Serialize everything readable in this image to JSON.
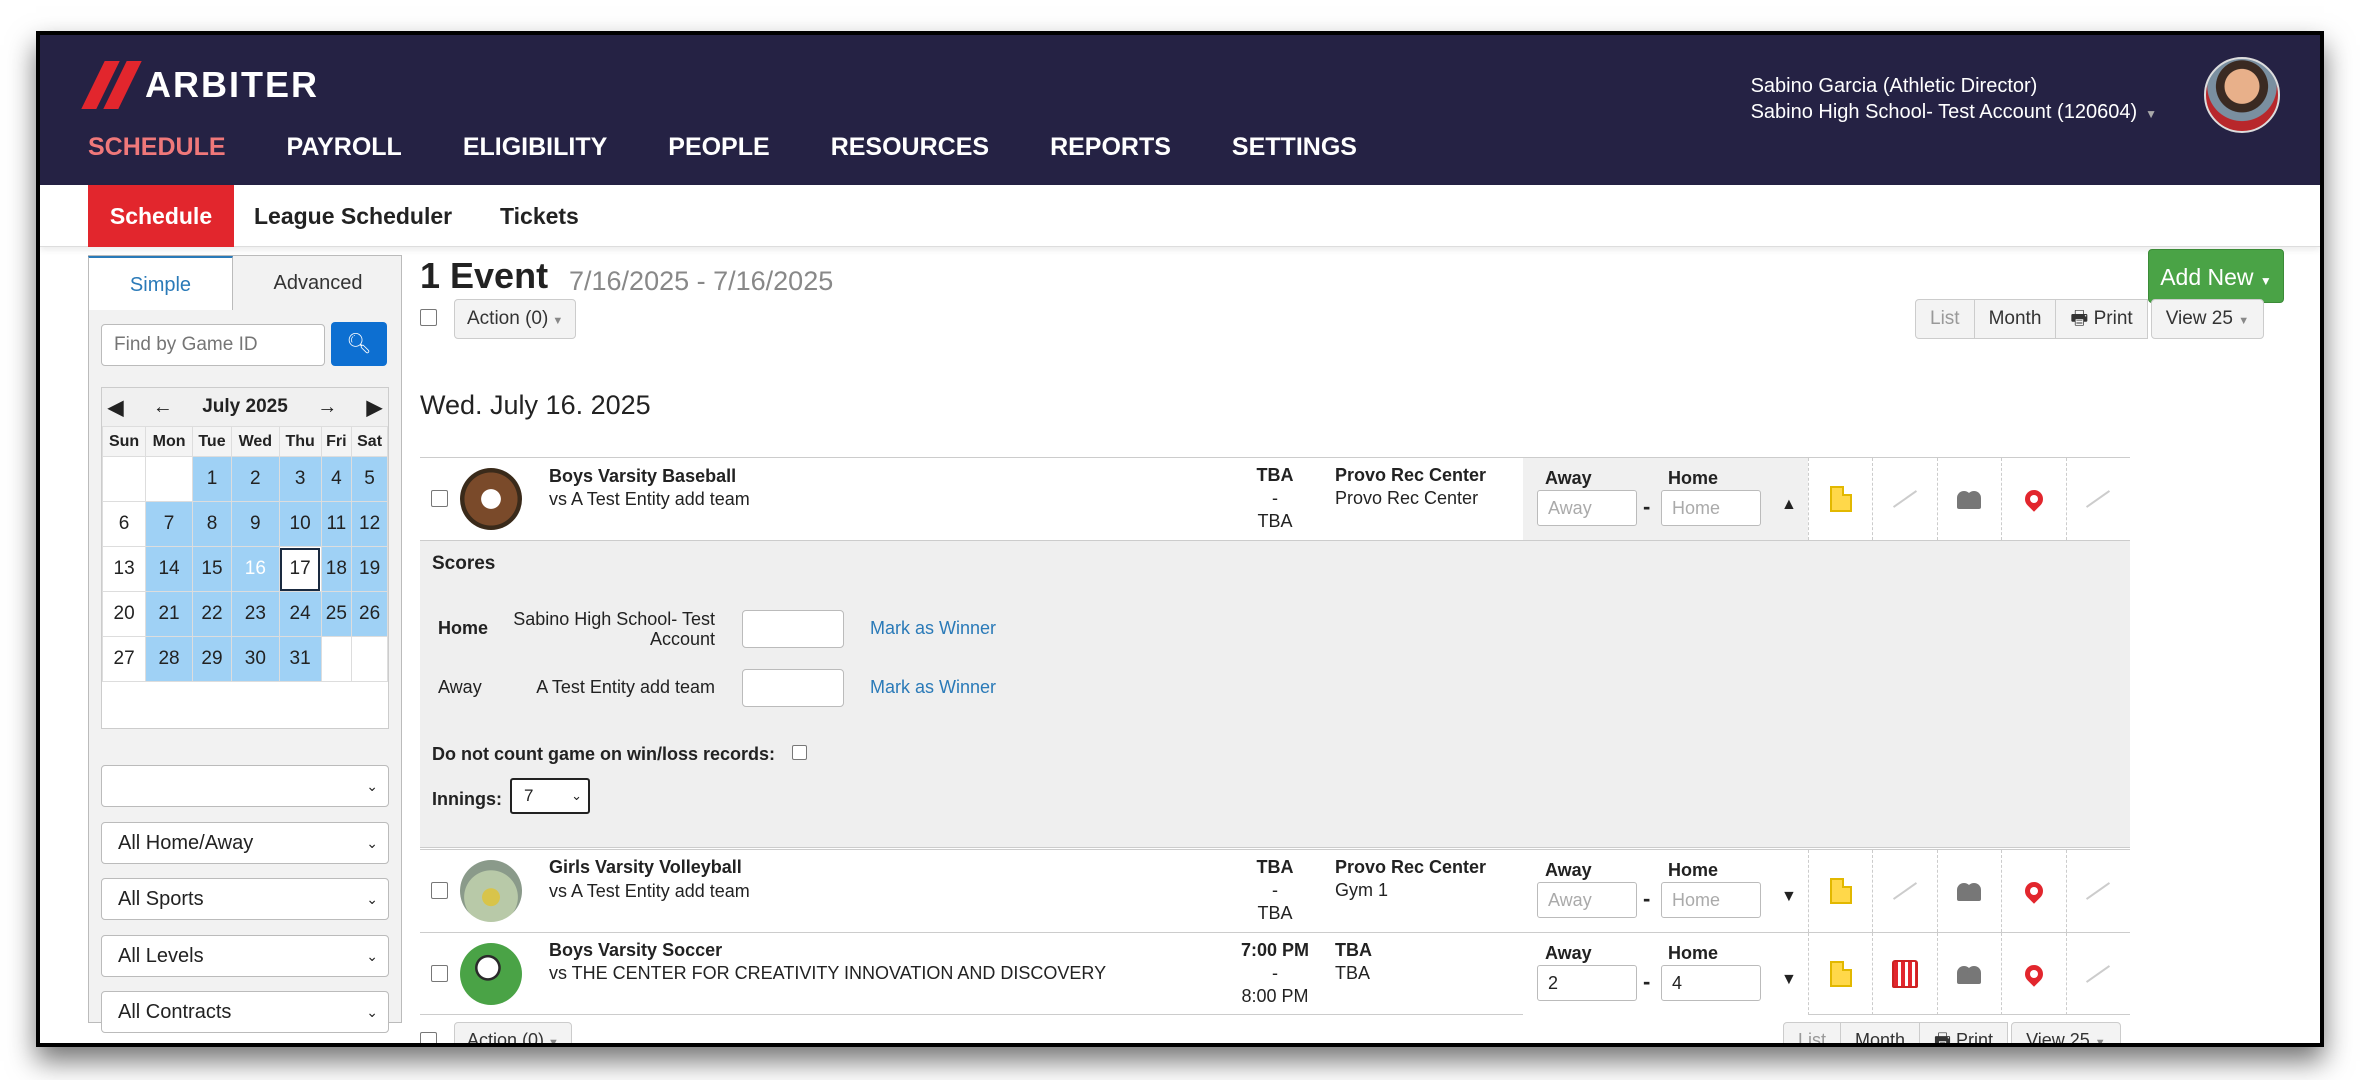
{
  "app": {
    "logo_text": "ARBITER"
  },
  "nav": [
    "SCHEDULE",
    "PAYROLL",
    "ELIGIBILITY",
    "PEOPLE",
    "RESOURCES",
    "REPORTS",
    "SETTINGS"
  ],
  "user": {
    "name": "Sabino Garcia (Athletic Director)",
    "account": "Sabino High School- Test Account (120604)"
  },
  "subnav": [
    "Schedule",
    "League Scheduler",
    "Tickets"
  ],
  "sidebar": {
    "tabs": [
      "Simple",
      "Advanced"
    ],
    "search_placeholder": "Find by Game ID",
    "calendar": {
      "month": "July 2025",
      "weekdays": [
        "Sun",
        "Mon",
        "Tue",
        "Wed",
        "Thu",
        "Fri",
        "Sat"
      ],
      "weeks": [
        [
          "",
          "",
          "1",
          "2",
          "3",
          "4",
          "5"
        ],
        [
          "6",
          "7",
          "8",
          "9",
          "10",
          "11",
          "12"
        ],
        [
          "13",
          "14",
          "15",
          "16",
          "17",
          "18",
          "19"
        ],
        [
          "20",
          "21",
          "22",
          "23",
          "24",
          "25",
          "26"
        ],
        [
          "27",
          "28",
          "29",
          "30",
          "31",
          "",
          ""
        ]
      ],
      "selected_day": "16",
      "today": "17"
    },
    "filters": [
      "",
      "All Home/Away",
      "All Sports",
      "All Levels",
      "All Contracts"
    ]
  },
  "main": {
    "count_title": "1 Event",
    "date_range": "7/16/2025 - 7/16/2025",
    "add_new": "Add New",
    "action_label": "Action (0)",
    "view_buttons": [
      "List",
      "Month",
      "Print",
      "View 25"
    ],
    "date_heading": "Wed. July 16. 2025",
    "events": [
      {
        "team": "Boys Varsity Baseball",
        "opponent": "vs A Test Entity add team",
        "time_start": "TBA",
        "time_sep": "-",
        "time_end": "TBA",
        "location": "Provo Rec Center",
        "sublocation": "Provo Rec Center",
        "away_label": "Away",
        "home_label": "Home",
        "away_value": "Away",
        "home_value": "Home",
        "expanded": true
      },
      {
        "team": "Girls Varsity Volleyball",
        "opponent": "vs A Test Entity add team",
        "time_start": "TBA",
        "time_sep": "-",
        "time_end": "TBA",
        "location": "Provo Rec Center",
        "sublocation": "Gym 1",
        "away_label": "Away",
        "home_label": "Home",
        "away_value": "Away",
        "home_value": "Home",
        "expanded": false
      },
      {
        "team": "Boys Varsity Soccer",
        "opponent": "vs THE CENTER FOR CREATIVITY INNOVATION AND DISCOVERY",
        "time_start": "7:00 PM",
        "time_sep": "-",
        "time_end": "8:00 PM",
        "location": "TBA",
        "sublocation": "TBA",
        "away_label": "Away",
        "home_label": "Home",
        "away_value": "2",
        "home_value": "4",
        "expanded": false
      }
    ],
    "scores": {
      "heading": "Scores",
      "home_label": "Home",
      "home_team": "Sabino High School- Test Account",
      "away_label": "Away",
      "away_team": "A Test Entity add team",
      "mark_winner": "Mark as Winner",
      "no_count_label": "Do not count game on win/loss records:",
      "innings_label": "Innings:",
      "innings_value": "7"
    }
  },
  "colors": {
    "brand_red": "#e2262d",
    "nav_bg": "#252244",
    "add_green": "#4aa346",
    "calendar_range": "#9fd1f5",
    "link": "#2a7ab8"
  }
}
